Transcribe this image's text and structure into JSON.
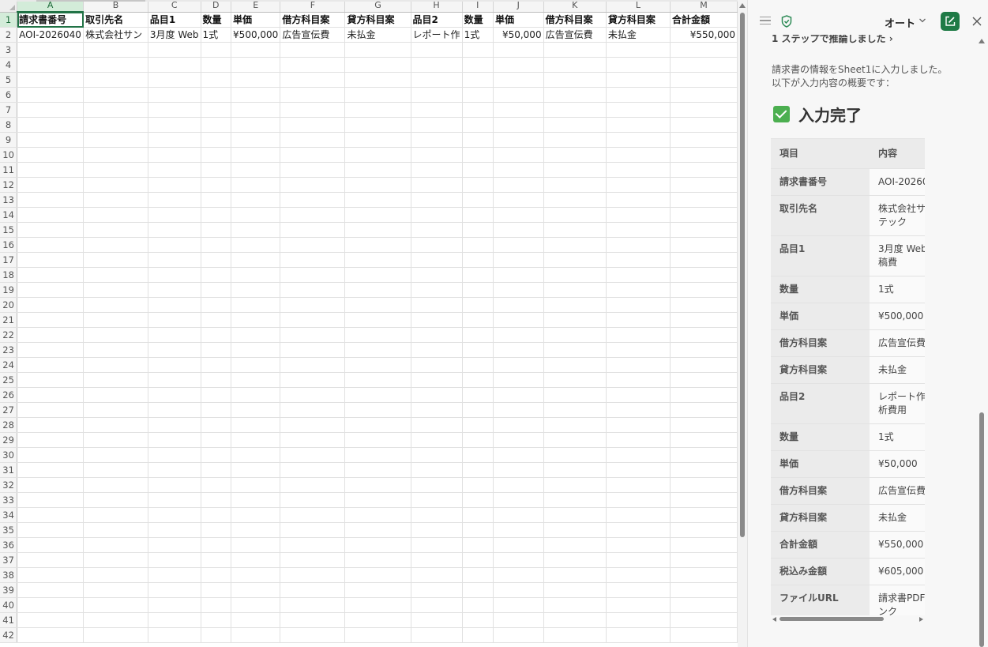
{
  "sheet": {
    "columns": [
      "A",
      "B",
      "C",
      "D",
      "E",
      "F",
      "G",
      "H",
      "I",
      "J",
      "K",
      "L",
      "M"
    ],
    "active_column": "A",
    "active_row": 1,
    "row_count": 42,
    "header_row": [
      "請求書番号",
      "取引先名",
      "品目1",
      "数量",
      "単価",
      "借方科目案",
      "貸方科目案",
      "品目2",
      "数量",
      "単価",
      "借方科目案",
      "貸方科目案",
      "合計金額"
    ],
    "data_row": [
      "AOI-2026040",
      "株式会社サン",
      "3月度 Web",
      "1式",
      "¥500,000",
      "広告宣伝費",
      "未払金",
      "レポート作",
      "1式",
      "¥50,000",
      "広告宣伝費",
      "未払金",
      "¥550,000"
    ]
  },
  "panel": {
    "mode_label": "オート",
    "step_text": "1 ステップで推論しました ›",
    "intro_line1": "請求書の情報をSheet1に入力しました。",
    "intro_line2": "以下が入力内容の概要です：",
    "done_title": "入力完了",
    "table": {
      "header": [
        "項目",
        "内容"
      ],
      "rows": [
        [
          "請求書番号",
          "AOI-20260"
        ],
        [
          "取引先名",
          "株式会社サ\nテック"
        ],
        [
          "品目1",
          "3月度 Web\n稿費"
        ],
        [
          "数量",
          "1式"
        ],
        [
          "単価",
          "¥500,000"
        ],
        [
          "借方科目案",
          "広告宣伝費"
        ],
        [
          "貸方科目案",
          "未払金"
        ],
        [
          "品目2",
          "レポート作\n析費用"
        ],
        [
          "数量",
          "1式"
        ],
        [
          "単価",
          "¥50,000"
        ],
        [
          "借方科目案",
          "広告宣伝費"
        ],
        [
          "貸方科目案",
          "未払金"
        ],
        [
          "合計金額",
          "¥550,000"
        ],
        [
          "税込み金額",
          "¥605,000"
        ],
        [
          "ファイルURL",
          "請求書PDF\nンク"
        ]
      ]
    }
  },
  "colors": {
    "accent": "#217346",
    "compose": "#1f7a46",
    "check": "#4caf50"
  },
  "icons": [
    "menu-icon",
    "shield-icon",
    "chevron-down-icon",
    "compose-icon",
    "close-icon",
    "check-icon"
  ]
}
